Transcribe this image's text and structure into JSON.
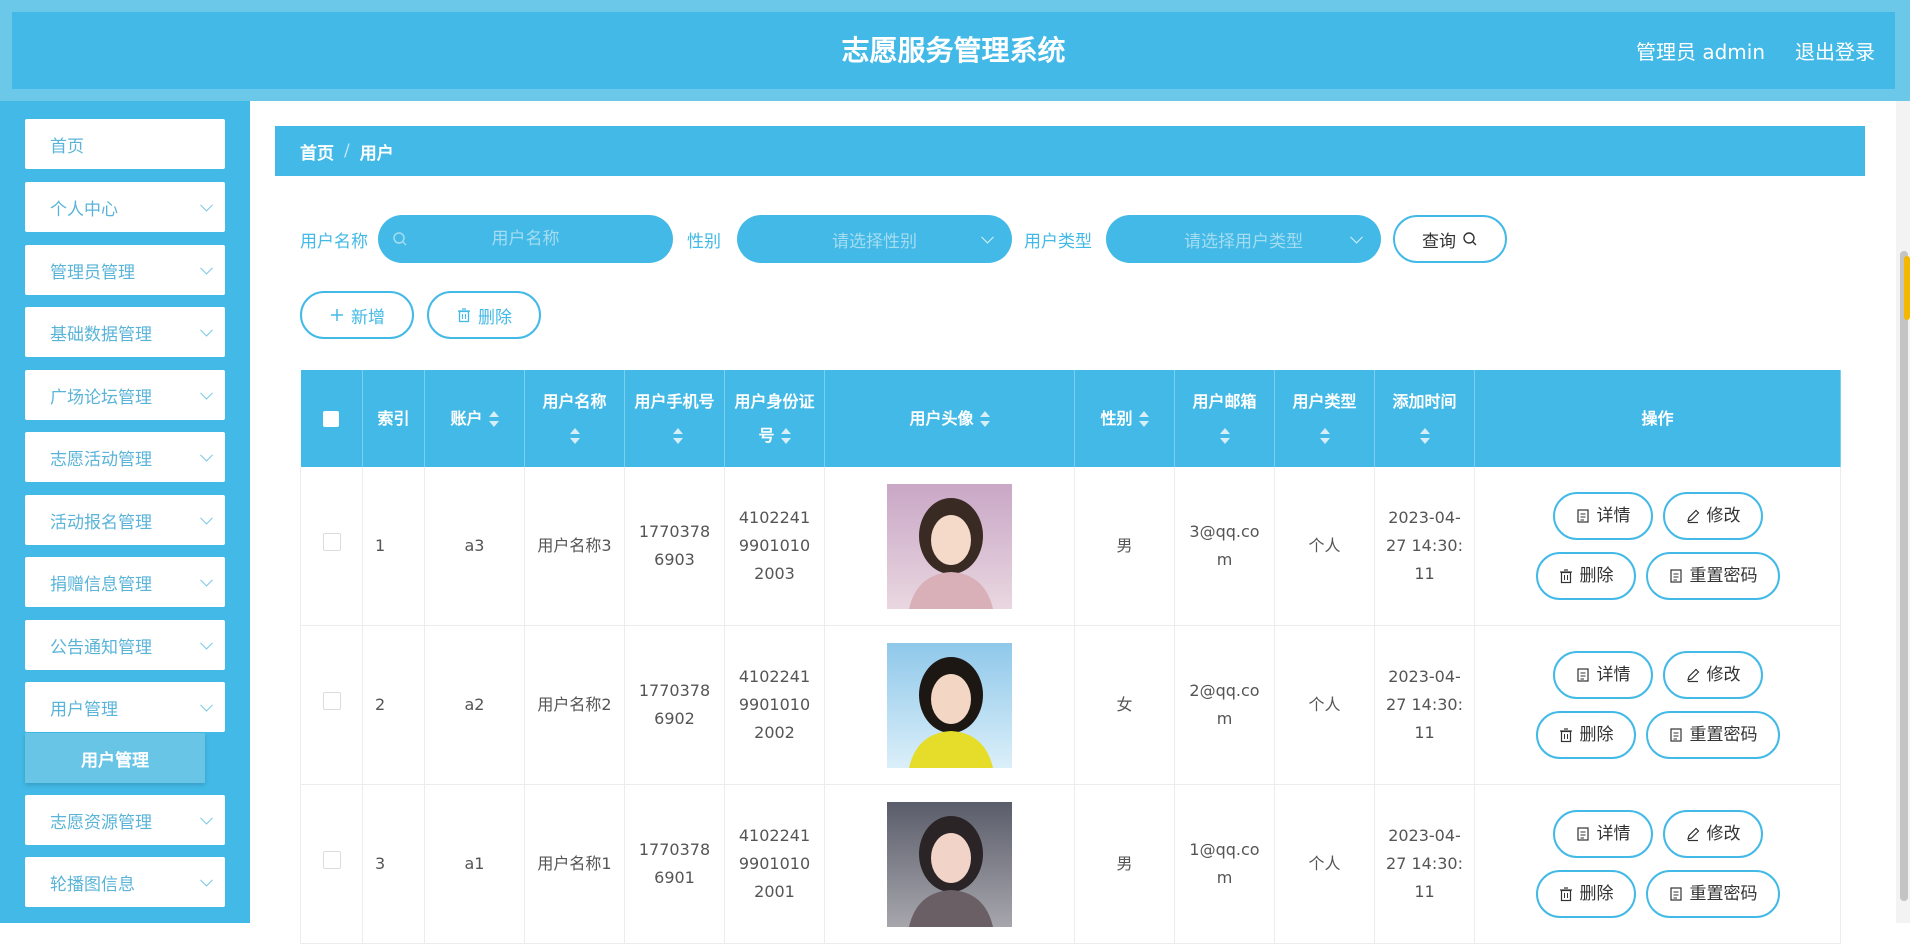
{
  "header": {
    "title": "志愿服务管理系统",
    "user": "管理员 admin",
    "logout": "退出登录"
  },
  "sidebar": {
    "items": [
      {
        "label": "首页"
      },
      {
        "label": "个人中心"
      },
      {
        "label": "管理员管理"
      },
      {
        "label": "基础数据管理"
      },
      {
        "label": "广场论坛管理"
      },
      {
        "label": "志愿活动管理"
      },
      {
        "label": "活动报名管理"
      },
      {
        "label": "捐赠信息管理"
      },
      {
        "label": "公告通知管理"
      },
      {
        "label": "用户管理"
      },
      {
        "label": "志愿资源管理"
      },
      {
        "label": "轮播图信息"
      }
    ],
    "subitem": "用户管理"
  },
  "breadcrumb": {
    "home": "首页",
    "sep": "/",
    "current": "用户"
  },
  "search": {
    "name_label": "用户名称",
    "name_placeholder": "用户名称",
    "gender_label": "性别",
    "gender_placeholder": "请选择性别",
    "type_label": "用户类型",
    "type_placeholder": "请选择用户类型",
    "query_button": "查询"
  },
  "actions": {
    "add": "新增",
    "delete": "删除"
  },
  "table": {
    "headers": [
      "索引",
      "账户",
      "用户名称",
      "用户手机号",
      "用户身份证号",
      "用户头像",
      "性别",
      "用户邮箱",
      "用户类型",
      "添加时间",
      "操作"
    ],
    "rows": [
      {
        "index": "1",
        "account": "a3",
        "name": "用户名称3",
        "phone": "17703786903",
        "idcard": "410224199010102003",
        "gender": "男",
        "email": "3@qq.com",
        "type": "个人",
        "time": "2023-04-27 14:30:11"
      },
      {
        "index": "2",
        "account": "a2",
        "name": "用户名称2",
        "phone": "17703786902",
        "idcard": "410224199010102002",
        "gender": "女",
        "email": "2@qq.com",
        "type": "个人",
        "time": "2023-04-27 14:30:11"
      },
      {
        "index": "3",
        "account": "a1",
        "name": "用户名称1",
        "phone": "17703786901",
        "idcard": "410224199010102001",
        "gender": "男",
        "email": "1@qq.com",
        "type": "个人",
        "time": "2023-04-27 14:30:11"
      }
    ],
    "row_buttons": {
      "detail": "详情",
      "edit": "修改",
      "delete": "删除",
      "reset": "重置密码"
    }
  },
  "colors": {
    "primary": "#42b9e6",
    "header_outer": "#6cc8e8",
    "sub_item": "#68c5e6"
  }
}
